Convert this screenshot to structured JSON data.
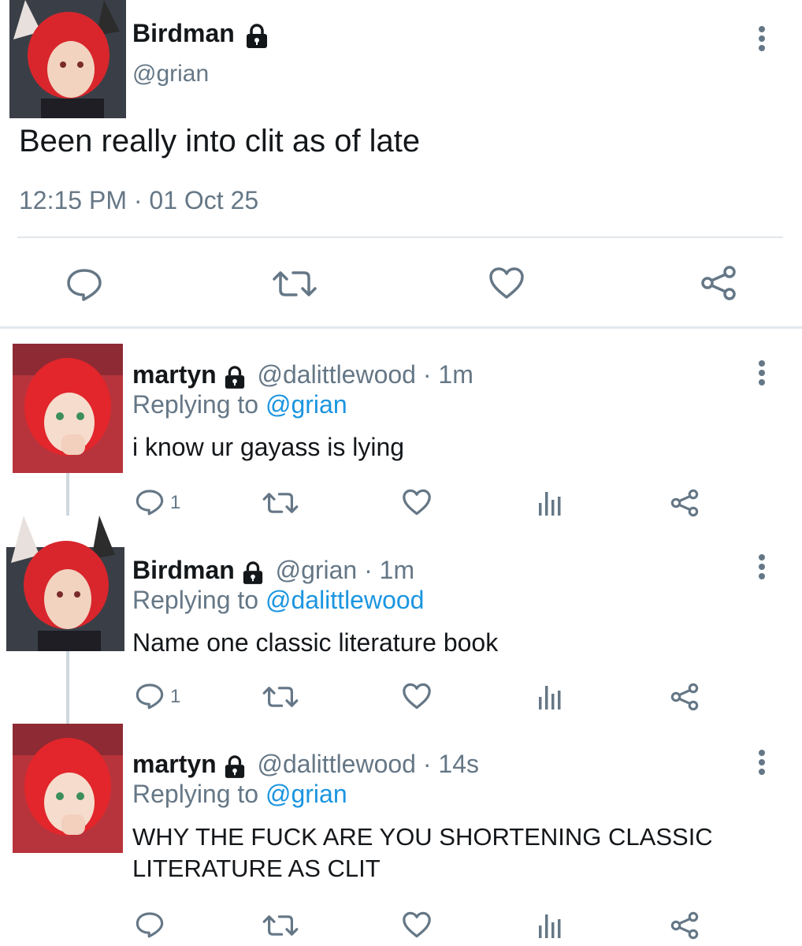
{
  "main_tweet": {
    "display_name": "Birdman",
    "handle": "@grian",
    "text": "Been really into clit as of late",
    "timestamp": "12:15 PM · 01 Oct 25"
  },
  "replies": [
    {
      "display_name": "martyn",
      "handle": "@dalittlewood",
      "time": "· 1m",
      "replying_prefix": "Replying to",
      "replying_to": "@grian",
      "text": "i know ur gayass is lying",
      "reply_count": "1"
    },
    {
      "display_name": "Birdman",
      "handle": "@grian",
      "time": "· 1m",
      "replying_prefix": "Replying to",
      "replying_to": "@dalittlewood",
      "text": "Name one classic literature book",
      "reply_count": "1"
    },
    {
      "display_name": "martyn",
      "handle": "@dalittlewood",
      "time": "· 14s",
      "replying_prefix": "Replying to",
      "replying_to": "@grian",
      "text_line1": "WHY THE FUCK ARE YOU SHORTENING CLASSIC",
      "text_line2": "LITERATURE AS CLIT"
    }
  ],
  "icons": [
    "lock-icon",
    "more-icon",
    "reply-icon",
    "retweet-icon",
    "like-icon",
    "analytics-icon",
    "share-icon"
  ],
  "colors": {
    "link": "#1b95e0",
    "secondary": "#657786",
    "divider": "#e1e8ed",
    "text": "#14171a"
  }
}
